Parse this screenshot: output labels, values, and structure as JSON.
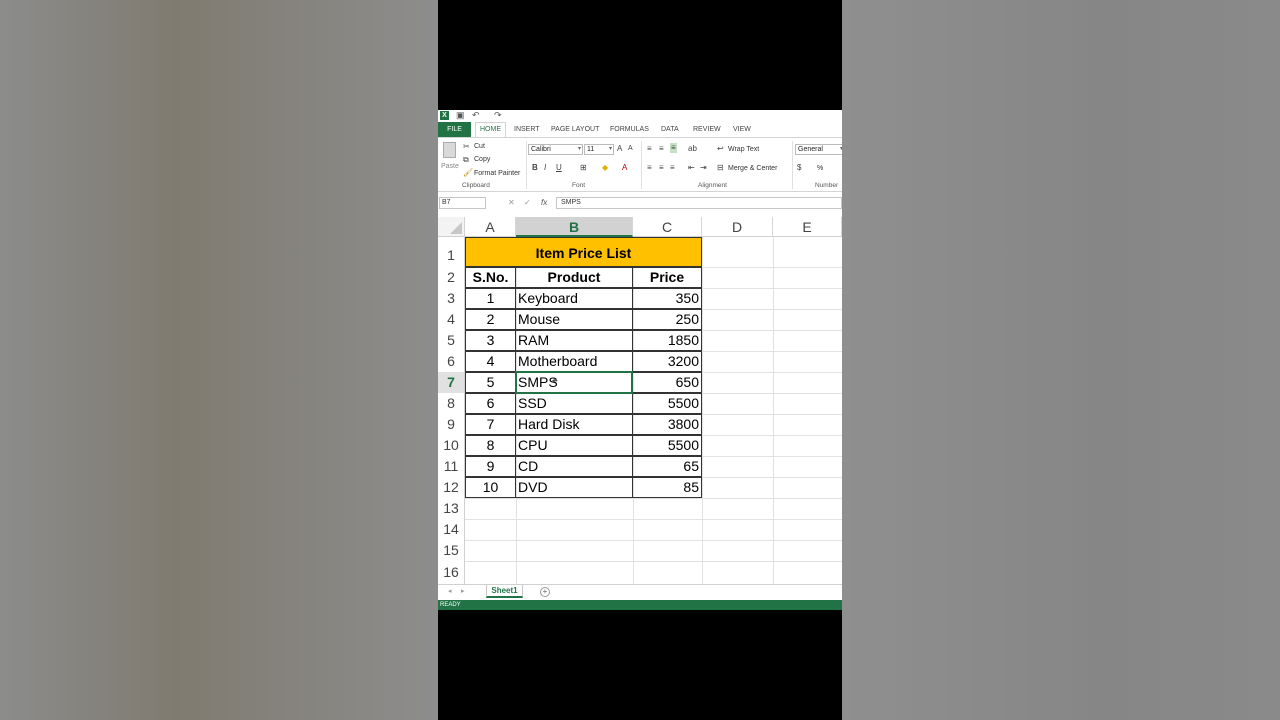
{
  "ribbon_tabs": [
    "FILE",
    "HOME",
    "INSERT",
    "PAGE LAYOUT",
    "FORMULAS",
    "DATA",
    "REVIEW",
    "VIEW"
  ],
  "clipboard": {
    "paste": "Paste",
    "cut": "Cut",
    "copy": "Copy",
    "format_painter": "Format Painter",
    "group": "Clipboard"
  },
  "font": {
    "name": "Calibri",
    "size": "11",
    "group": "Font"
  },
  "alignment": {
    "wrap_text": "Wrap Text",
    "merge_center": "Merge & Center",
    "group": "Alignment"
  },
  "number": {
    "format": "General",
    "percent": "%",
    "group": "Number"
  },
  "formula_bar": {
    "name_box": "B7",
    "content": "SMPS",
    "fx": "fx"
  },
  "columns": [
    "A",
    "B",
    "C",
    "D",
    "E"
  ],
  "selected_column": "B",
  "rows": [
    "1",
    "2",
    "3",
    "4",
    "5",
    "6",
    "7",
    "8",
    "9",
    "10",
    "11",
    "12",
    "13",
    "14",
    "15",
    "16"
  ],
  "selected_row": "7",
  "sheet": {
    "title": "Item Price List",
    "headers": [
      "S.No.",
      "Product",
      "Price"
    ],
    "items": [
      {
        "sno": "1",
        "product": "Keyboard",
        "price": "350"
      },
      {
        "sno": "2",
        "product": "Mouse",
        "price": "250"
      },
      {
        "sno": "3",
        "product": "RAM",
        "price": "1850"
      },
      {
        "sno": "4",
        "product": "Motherboard",
        "price": "3200"
      },
      {
        "sno": "5",
        "product": "SMPS",
        "price": "650"
      },
      {
        "sno": "6",
        "product": "SSD",
        "price": "5500"
      },
      {
        "sno": "7",
        "product": "Hard Disk",
        "price": "3800"
      },
      {
        "sno": "8",
        "product": "CPU",
        "price": "5500"
      },
      {
        "sno": "9",
        "product": "CD",
        "price": "65"
      },
      {
        "sno": "10",
        "product": "DVD",
        "price": "85"
      }
    ]
  },
  "sheet_tabs": [
    "Sheet1"
  ],
  "status": "READY",
  "colors": {
    "excel_green": "#217346",
    "title_fill": "#ffc000"
  }
}
